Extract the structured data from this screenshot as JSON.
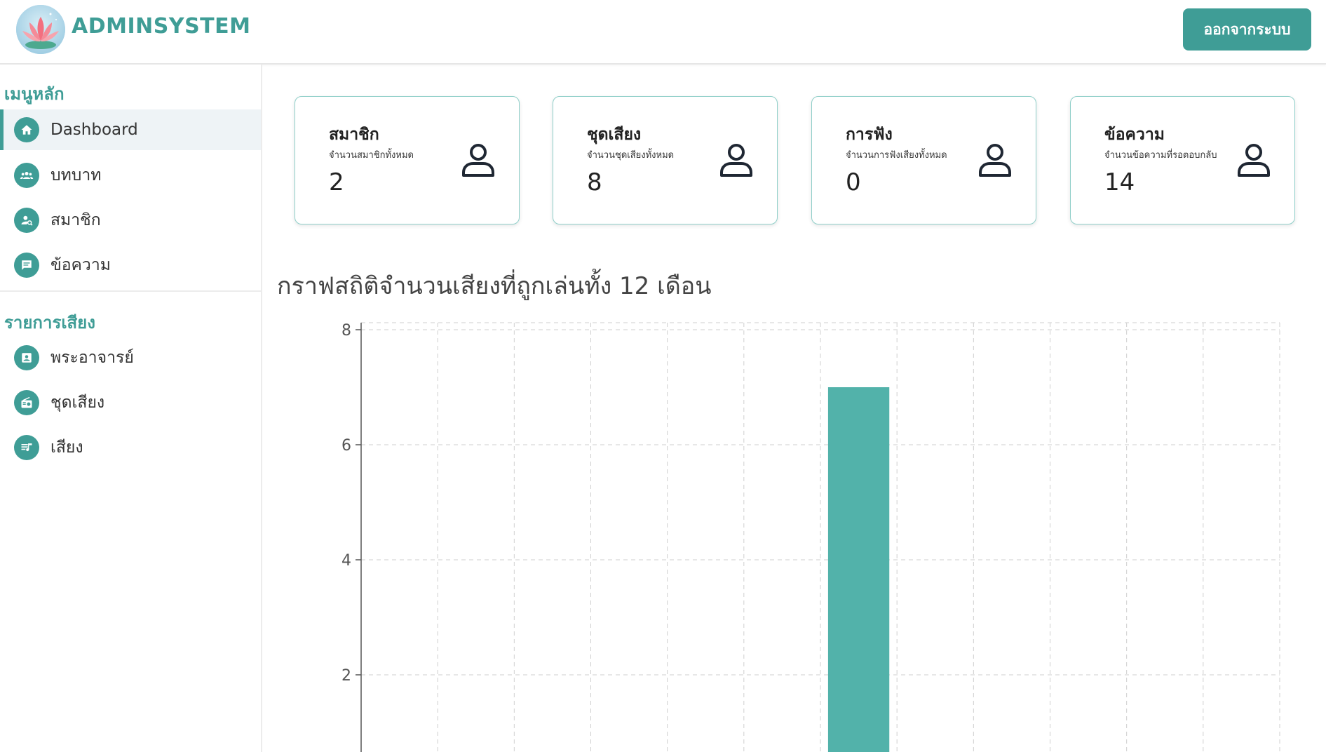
{
  "header": {
    "brand": "ADMINSYSTEM",
    "logout_label": "ออกจากระบบ"
  },
  "sidebar": {
    "main_title": "เมนูหลัก",
    "main_items": [
      {
        "label": "Dashboard",
        "icon": "home-icon",
        "active": true
      },
      {
        "label": "บทบาท",
        "icon": "group-icon",
        "active": false
      },
      {
        "label": "สมาชิก",
        "icon": "member-search-icon",
        "active": false
      },
      {
        "label": "ข้อความ",
        "icon": "message-icon",
        "active": false
      }
    ],
    "audio_title": "รายการเสียง",
    "audio_items": [
      {
        "label": "พระอาจารย์",
        "icon": "contact-card-icon"
      },
      {
        "label": "ชุดเสียง",
        "icon": "radio-icon"
      },
      {
        "label": "เสียง",
        "icon": "playlist-icon"
      }
    ]
  },
  "cards": [
    {
      "title": "สมาชิก",
      "subtitle": "จำนวนสมาชิกทั้งหมด",
      "value": "2"
    },
    {
      "title": "ชุดเสียง",
      "subtitle": "จำนวนชุดเสียงทั้งหมด",
      "value": "8"
    },
    {
      "title": "การฟัง",
      "subtitle": "จำนวนการฟังเสียงทั้งหมด",
      "value": "0"
    },
    {
      "title": "ข้อความ",
      "subtitle": "จำนวนข้อความที่รอตอบกลับ",
      "value": "14"
    }
  ],
  "chart_title": "กราฟสถิติจำนวนเสียงที่ถูกเล่นทั้ง 12 เดือน",
  "colors": {
    "accent": "#3f9d96",
    "bar": "#52b2aa",
    "active_bg": "#eef3f6",
    "card_border": "#8fcfc9"
  },
  "chart_data": {
    "type": "bar",
    "title": "กราฟสถิติจำนวนเสียงที่ถูกเล่นทั้ง 12 เดือน",
    "categories": [
      "",
      "",
      "",
      "",
      "",
      "",
      "",
      "",
      "",
      "",
      "",
      ""
    ],
    "values": [
      0,
      0,
      0,
      0,
      0,
      0,
      7,
      0,
      0,
      0,
      0,
      0
    ],
    "ylim_visible": [
      1.3,
      8
    ],
    "yticks": [
      "2",
      "4",
      "6",
      "8"
    ],
    "grid": true,
    "xlabel": "",
    "ylabel": ""
  }
}
